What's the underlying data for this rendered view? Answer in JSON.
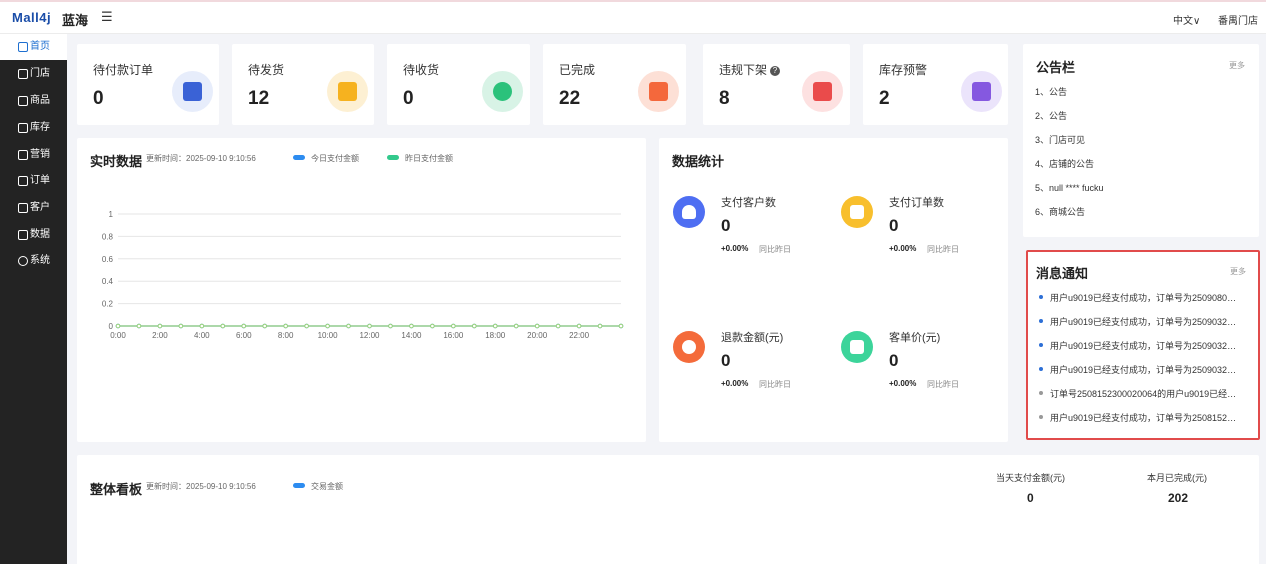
{
  "header": {
    "logo": "Mall4j",
    "shop_name": "蓝海",
    "menu_icon": "menu-fold-icon",
    "language": "中文∨",
    "store": "番禺门店"
  },
  "sidebar": {
    "items": [
      {
        "label": "首页",
        "icon": "home-icon",
        "active": true
      },
      {
        "label": "门店",
        "icon": "store-icon"
      },
      {
        "label": "商品",
        "icon": "goods-icon"
      },
      {
        "label": "库存",
        "icon": "inventory-icon"
      },
      {
        "label": "营销",
        "icon": "gift-icon"
      },
      {
        "label": "订单",
        "icon": "order-icon"
      },
      {
        "label": "客户",
        "icon": "customer-icon"
      },
      {
        "label": "数据",
        "icon": "data-icon"
      },
      {
        "label": "系统",
        "icon": "settings-icon"
      }
    ]
  },
  "stats": [
    {
      "label": "待付款订单",
      "value": "0",
      "icon": "wallet-icon",
      "circle_color": "#e7edfb",
      "icon_color": "#3a62d6"
    },
    {
      "label": "待发货",
      "value": "12",
      "icon": "truck-icon",
      "circle_color": "#fdf0d3",
      "icon_color": "#f6b21f"
    },
    {
      "label": "待收货",
      "value": "0",
      "icon": "headset-icon",
      "circle_color": "#d8f3e6",
      "icon_color": "#2bc27b"
    },
    {
      "label": "已完成",
      "value": "22",
      "icon": "shopping-bag-icon",
      "circle_color": "#fde0d6",
      "icon_color": "#f4683c"
    },
    {
      "label": "违规下架",
      "value": "8",
      "icon": "warning-doc-icon",
      "circle_color": "#fde1e1",
      "icon_color": "#ea4b4b"
    },
    {
      "label": "库存预警",
      "value": "2",
      "icon": "box-icon",
      "circle_color": "#ebe4fb",
      "icon_color": "#8558e0"
    }
  ],
  "realtime": {
    "title": "实时数据",
    "update_time": "更新时间：2025-09-10   9:10:56",
    "legend": [
      {
        "label": "今日支付金额",
        "color": "#2d8cf0"
      },
      {
        "label": "昨日支付金额",
        "color": "#33c98c"
      }
    ]
  },
  "chart_data": {
    "type": "line",
    "x": [
      "0:00",
      "2:00",
      "4:00",
      "6:00",
      "8:00",
      "10:00",
      "12:00",
      "14:00",
      "16:00",
      "18:00",
      "20:00",
      "22:00"
    ],
    "y_ticks": [
      "0",
      "0.2",
      "0.4",
      "0.6",
      "0.8",
      "1"
    ],
    "ylim": [
      0,
      1
    ],
    "grid": true,
    "series": [
      {
        "name": "今日支付金额",
        "color": "#2d8cf0",
        "values": [
          0,
          0,
          0,
          0,
          0,
          0,
          0,
          0,
          0,
          0,
          0,
          0,
          0,
          0,
          0,
          0,
          0,
          0,
          0,
          0,
          0,
          0,
          0,
          0,
          0
        ]
      },
      {
        "name": "昨日支付金额",
        "color": "#9ad37a",
        "values": [
          0,
          0,
          0,
          0,
          0,
          0,
          0,
          0,
          0,
          0,
          0,
          0,
          0,
          0,
          0,
          0,
          0,
          0,
          0,
          0,
          0,
          0,
          0,
          0,
          0
        ]
      }
    ]
  },
  "data_stats": {
    "title": "数据统计",
    "items": [
      {
        "label": "支付客户数",
        "value": "0",
        "change": "+0.00%",
        "compare": "同比昨日",
        "icon": "user-icon",
        "color": "#4e6ef2"
      },
      {
        "label": "支付订单数",
        "value": "0",
        "change": "+0.00%",
        "compare": "同比昨日",
        "icon": "clipboard-icon",
        "color": "#f8bf2d"
      },
      {
        "label": "退款金额(元)",
        "value": "0",
        "change": "+0.00%",
        "compare": "同比昨日",
        "icon": "refund-icon",
        "color": "#f46b3b"
      },
      {
        "label": "客单价(元)",
        "value": "0",
        "change": "+0.00%",
        "compare": "同比昨日",
        "icon": "bag-icon",
        "color": "#3cd49a"
      }
    ]
  },
  "notice_board": {
    "title": "公告栏",
    "more": "更多",
    "items": [
      "1、公告",
      "2、公告",
      "3、门店可见",
      "4、店铺的公告",
      "5、null **** fucku",
      "6、商城公告"
    ]
  },
  "messages": {
    "title": "消息通知",
    "more": "更多",
    "highlight_color": "#e14b4b",
    "items": [
      {
        "text": "用户u9019已经支付成功，订单号为2509080…",
        "dot": "#2d6fd6"
      },
      {
        "text": "用户u9019已经支付成功，订单号为2509032…",
        "dot": "#2d6fd6"
      },
      {
        "text": "用户u9019已经支付成功，订单号为2509032…",
        "dot": "#2d6fd6"
      },
      {
        "text": "用户u9019已经支付成功，订单号为2509032…",
        "dot": "#2d6fd6"
      },
      {
        "text": "订单号2508152300020064的用户u9019已经…",
        "dot": "#999999"
      },
      {
        "text": "用户u9019已经支付成功，订单号为2508152…",
        "dot": "#999999"
      }
    ]
  },
  "overview": {
    "title": "整体看板",
    "update_time": "更新时间：2025-09-10   9:10:56",
    "legend": "交易金额",
    "legend_color": "#2d8cf0",
    "kpis": [
      {
        "label": "当天支付金额(元)",
        "value": "0"
      },
      {
        "label": "本月已完成(元)",
        "value": "202"
      }
    ]
  }
}
